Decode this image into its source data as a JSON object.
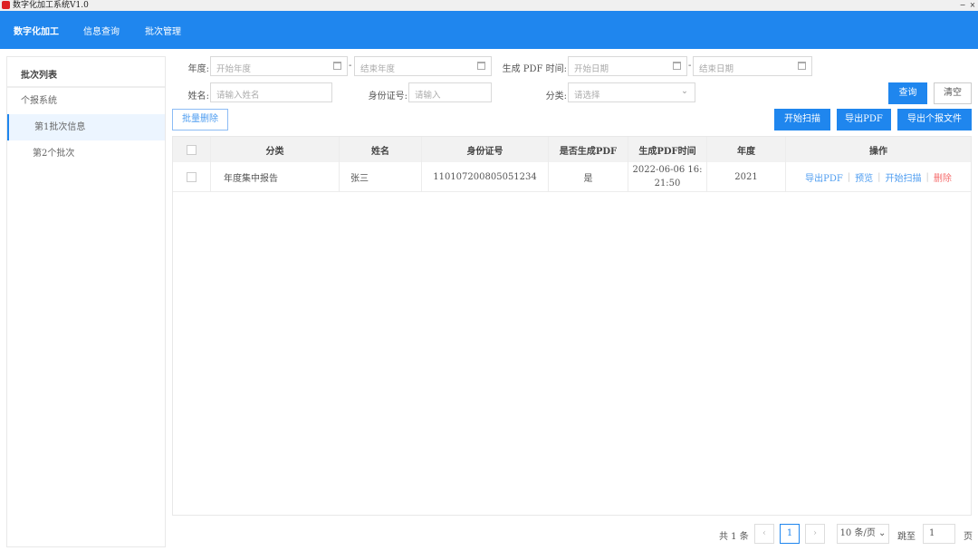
{
  "window": {
    "title": "数字化加工系统V1.0",
    "minimize": "−",
    "close": "×"
  },
  "nav": [
    "数字化加工",
    "信息查询",
    "批次管理"
  ],
  "sidebar": {
    "title": "批次列表",
    "group": "个报系统",
    "items": [
      "第1批次信息",
      "第2个批次"
    ]
  },
  "filters": {
    "year_label": "年度:",
    "year_start": "开始年度",
    "year_end": "结束年度",
    "dash": "-",
    "pdf_time_label": "生成 PDF 时间:",
    "date_start": "开始日期",
    "date_end": "结束日期",
    "name_label": "姓名:",
    "name_placeholder": "请输入姓名",
    "id_label": "身份证号:",
    "id_placeholder": "请输入",
    "category_label": "分类:",
    "category_placeholder": "请选择",
    "query": "查询",
    "clear": "清空"
  },
  "toolbar": {
    "batch_delete": "批量删除",
    "start_scan": "开始扫描",
    "export_pdf": "导出PDF",
    "export_report": "导出个报文件"
  },
  "table": {
    "headers": [
      "分类",
      "姓名",
      "身份证号",
      "是否生成PDF",
      "生成PDF时间",
      "年度",
      "操作"
    ],
    "rows": [
      {
        "category": "年度集中报告",
        "name": "张三",
        "id": "110107200805051234",
        "pdf": "是",
        "time1": "2022-06-06 16:",
        "time2": "21:50",
        "year": "2021",
        "actions": [
          "导出PDF",
          "预览",
          "开始扫描",
          "删除"
        ]
      }
    ]
  },
  "pagination": {
    "total": "共 1 条",
    "prev": "‹",
    "page": "1",
    "next": "›",
    "size": "10 条/页",
    "goto": "跳至",
    "goto_value": "1",
    "page_unit": "页"
  },
  "colors": {
    "primary": "#1f86ee",
    "danger": "#f56c6c"
  }
}
